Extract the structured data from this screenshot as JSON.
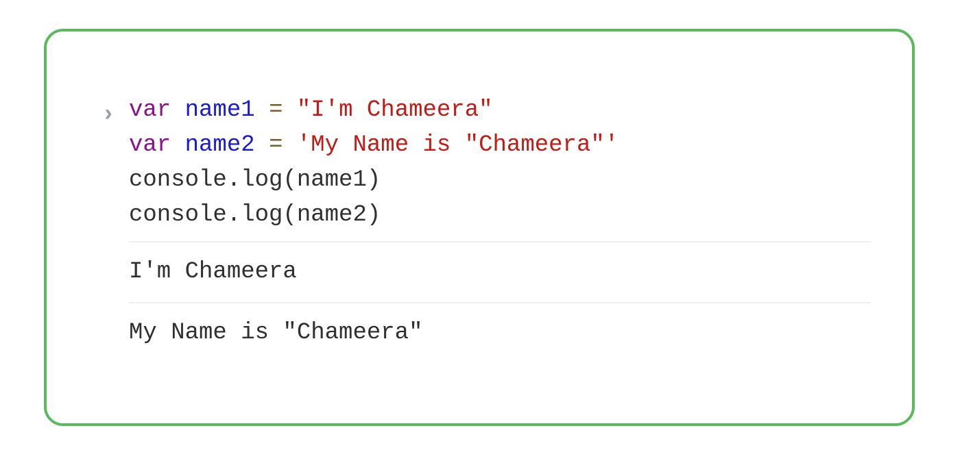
{
  "border_color": "#5cb85c",
  "prompt_glyph": "›",
  "code": {
    "line1": {
      "kw": "var",
      "name": "name1",
      "op": "=",
      "str": "\"I'm Chameera\""
    },
    "line2": {
      "kw": "var",
      "name": "name2",
      "op": "=",
      "str": "'My Name is \"Chameera\"'"
    },
    "line3": "console.log(name1)",
    "line4": "console.log(name2)"
  },
  "output": {
    "line1": "I'm Chameera",
    "line2": "My Name is \"Chameera\""
  }
}
